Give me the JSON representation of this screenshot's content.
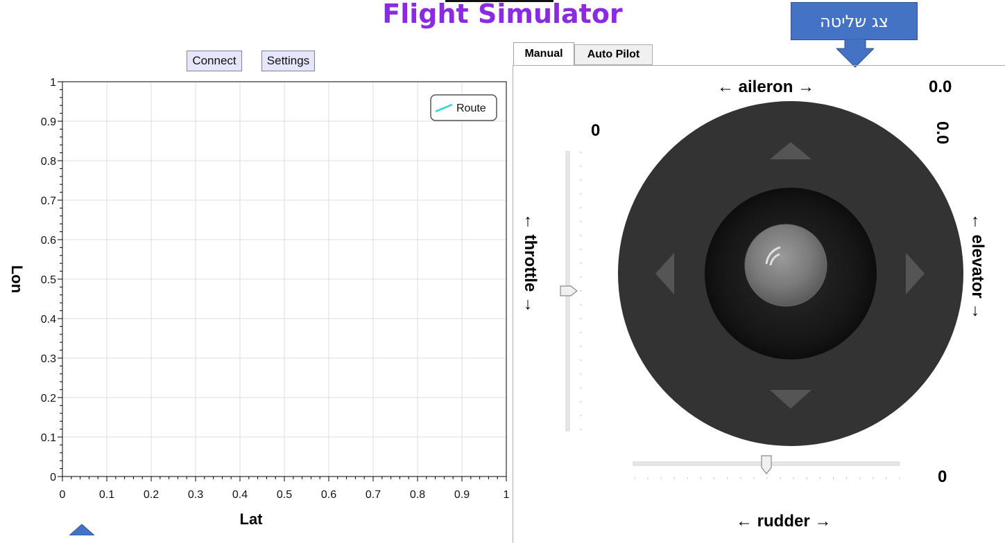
{
  "app": {
    "title": "Flight Simulator"
  },
  "callout": {
    "label": "צג שליטה"
  },
  "toolbar": {
    "connect_label": "Connect",
    "settings_label": "Settings"
  },
  "tabs": [
    {
      "label": "Manual",
      "active": true
    },
    {
      "label": "Auto Pilot",
      "active": false
    }
  ],
  "controls": {
    "aileron_label": "← aileron →",
    "aileron_value": "0.0",
    "elevator_label": "← elevator →",
    "elevator_value": "0.0",
    "throttle_label": "← throttle →",
    "throttle_value": "0",
    "rudder_label": "← rudder →",
    "rudder_value": "0",
    "throttle_level": 0.5,
    "rudder_level": 0.5
  },
  "chart_data": {
    "type": "line",
    "xlabel": "Lat",
    "ylabel": "Lon",
    "xlim": [
      0,
      1
    ],
    "ylim": [
      0,
      1
    ],
    "x_ticks": [
      "0",
      "0.1",
      "0.2",
      "0.3",
      "0.4",
      "0.5",
      "0.6",
      "0.7",
      "0.8",
      "0.9",
      "1"
    ],
    "y_ticks": [
      "0",
      "0.1",
      "0.2",
      "0.3",
      "0.4",
      "0.5",
      "0.6",
      "0.7",
      "0.8",
      "0.9",
      "1"
    ],
    "grid": true,
    "legend_position": "top-right",
    "series": [
      {
        "name": "Route",
        "color": "#2ad4d4",
        "x": [],
        "y": []
      }
    ]
  },
  "colors": {
    "title": "#8a2be2",
    "callout": "#4472c4",
    "joystick_outer": "#333333",
    "joystick_inner": "#1a1a1a"
  }
}
